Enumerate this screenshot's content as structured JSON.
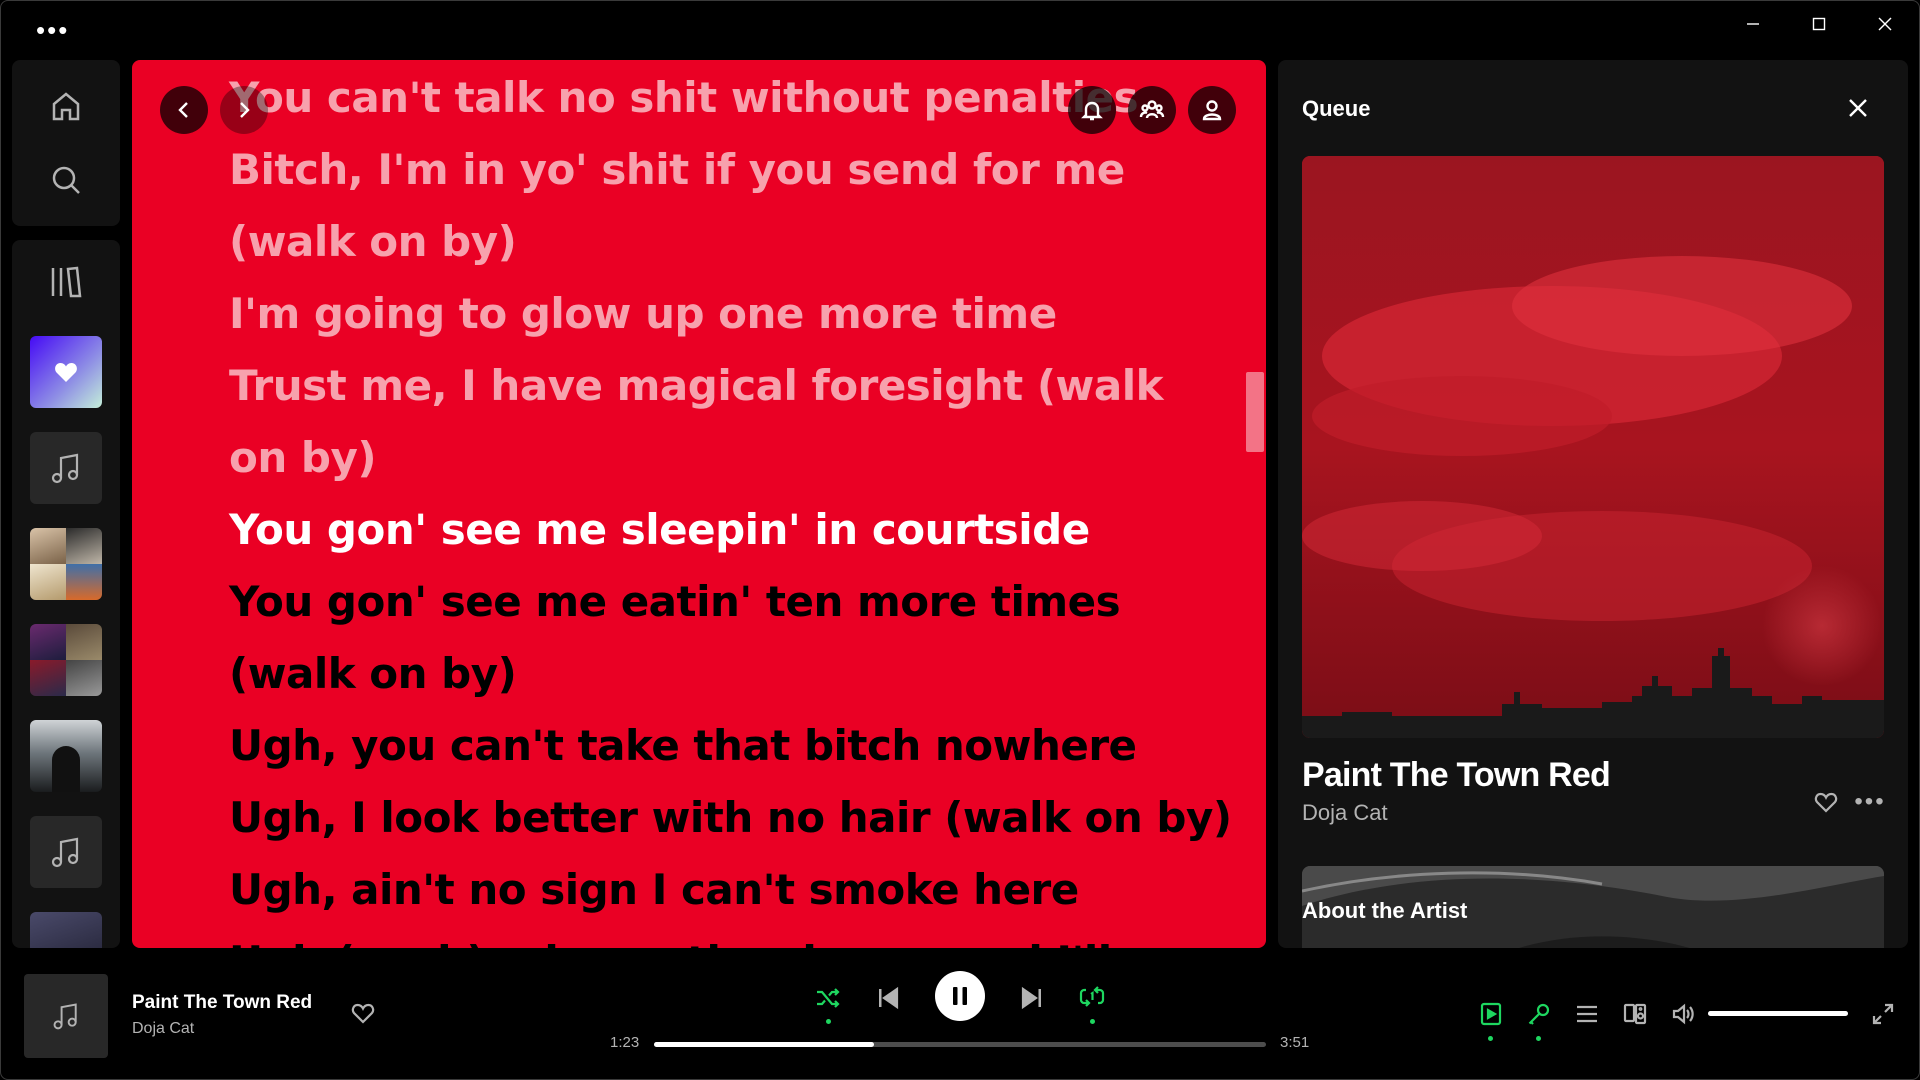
{
  "window": {
    "controls": [
      "minimize",
      "maximize",
      "close"
    ]
  },
  "sidebar": {
    "nav": [
      "home-icon",
      "search-icon"
    ],
    "library_icon": "library-icon",
    "items": [
      {
        "name": "liked-songs",
        "icon": "heart-icon",
        "colors": [
          "#450af5",
          "#c4efd9"
        ]
      },
      {
        "name": "playlist-1",
        "icon": "music-note-icon"
      },
      {
        "name": "playlist-2",
        "icon": "mosaic-cover"
      },
      {
        "name": "playlist-3",
        "icon": "mosaic-cover"
      },
      {
        "name": "artist-eminem",
        "icon": "artist-cover"
      },
      {
        "name": "playlist-4",
        "icon": "music-note-icon"
      },
      {
        "name": "playlist-5",
        "icon": "album-cover"
      }
    ]
  },
  "lyrics": {
    "background": "#ea0024",
    "lines": [
      {
        "text": "You can't talk no shit without penalties",
        "state": "past"
      },
      {
        "text": "Bitch, I'm in yo' shit if you send for me",
        "state": "past"
      },
      {
        "text": "(walk on by)",
        "state": "past"
      },
      {
        "text": "I'm going to glow up one more time",
        "state": "past"
      },
      {
        "text": "Trust me, I have magical foresight (walk",
        "state": "past"
      },
      {
        "text": "on by)",
        "state": "past"
      },
      {
        "text": "You gon' see me sleepin' in courtside",
        "state": "active"
      },
      {
        "text": "You gon' see me eatin' ten more times",
        "state": "future"
      },
      {
        "text": "(walk on by)",
        "state": "future"
      },
      {
        "text": "Ugh, you can't take that bitch nowhere",
        "state": "future"
      },
      {
        "text": "Ugh, I look better with no hair (walk on by)",
        "state": "future"
      },
      {
        "text": "Ugh, ain't no sign I can't smoke here",
        "state": "future"
      },
      {
        "text": "Ugh (yeah), gimme the chance and I'll go",
        "state": "future"
      }
    ]
  },
  "queue": {
    "title": "Queue",
    "track": "Paint The Town Red",
    "artist": "Doja Cat",
    "about_label": "About the Artist"
  },
  "player": {
    "track": "Paint The Town Red",
    "artist": "Doja Cat",
    "elapsed": "1:23",
    "duration": "3:51",
    "progress": 0.359,
    "volume": 1.0,
    "accent": "#1ed760"
  }
}
